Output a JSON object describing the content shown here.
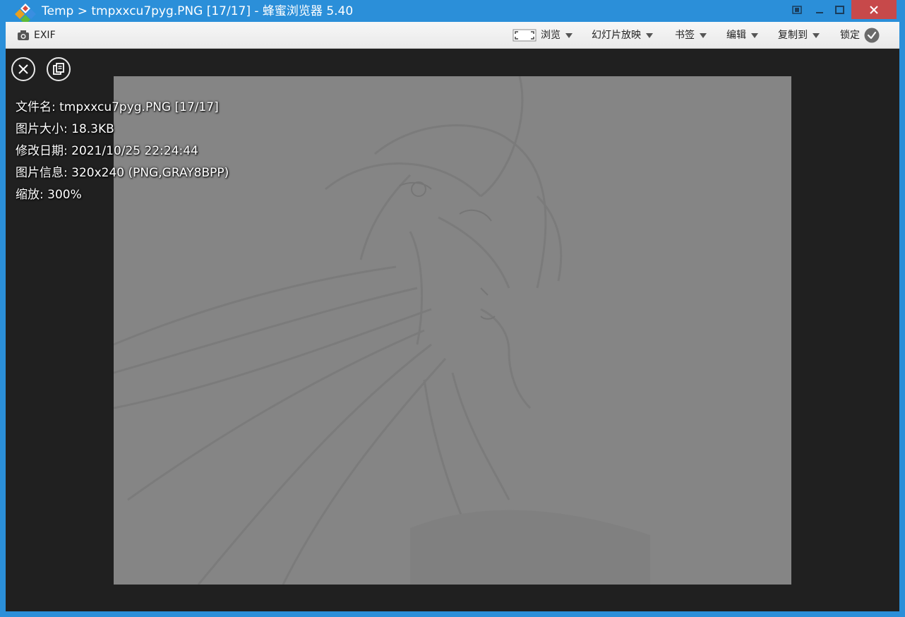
{
  "window": {
    "title": "Temp > tmpxxcu7pyg.PNG [17/17] - 蜂蜜浏览器 5.40",
    "logo_icon": "diamond-logo-icon",
    "controls": [
      "restore-small-icon",
      "minimize-icon",
      "maximize-icon",
      "close-icon"
    ],
    "close_color": "#c7494a",
    "titlebar_color": "#2b8fd9"
  },
  "toolbar": {
    "exif_label": "EXIF",
    "browse_label": "浏览",
    "slideshow_label": "幻灯片放映",
    "bookmark_label": "书签",
    "edit_label": "编辑",
    "copy_to_label": "复制到",
    "lock_label": "锁定"
  },
  "viewer": {
    "background": "#202020",
    "image_tone": "#858585",
    "buttons": [
      "close-circle-icon",
      "copy-circle-icon"
    ]
  },
  "info": {
    "filename": "文件名: tmpxxcu7pyg.PNG [17/17]",
    "filesize": "图片大小: 18.3KB",
    "modified": "修改日期: 2021/10/25 22:24:44",
    "imageinfo": "图片信息: 320x240 (PNG,GRAY8BPP)",
    "zoom": "缩放: 300%"
  }
}
